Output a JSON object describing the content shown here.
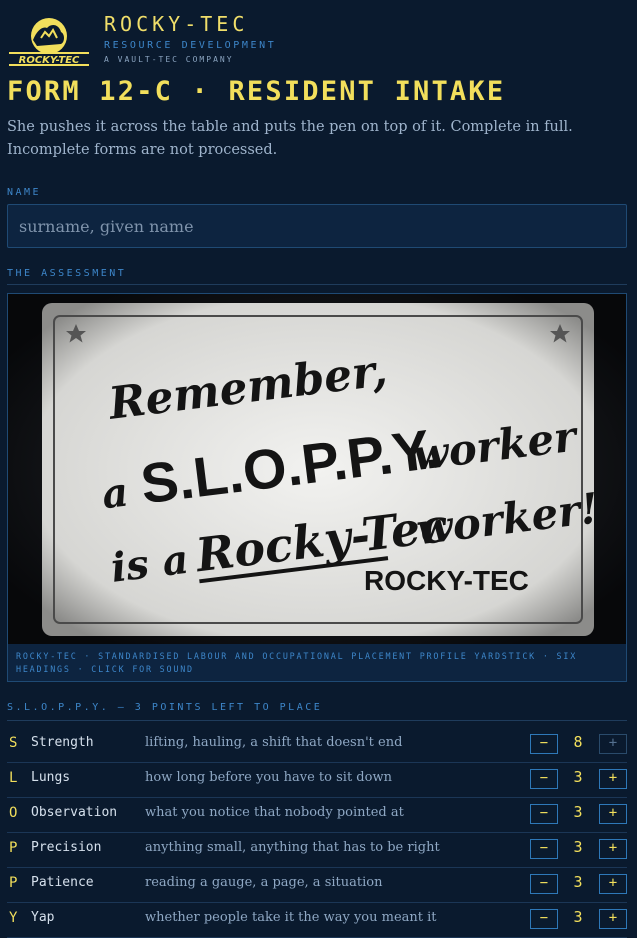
{
  "brand": {
    "name": "ROCKY-TEC",
    "subtitle": "RESOURCE DEVELOPMENT",
    "tagline": "A VAULT-TEC COMPANY",
    "logo_text": "ROCKY-TEC"
  },
  "form": {
    "title": "FORM 12-C · RESIDENT INTAKE",
    "intro": "She pushes it across the table and puts the pen on top of it. Complete in full. Incomplete forms are not processed."
  },
  "name_field": {
    "label": "NAME",
    "placeholder": "surname, given name",
    "value": ""
  },
  "assessment": {
    "label": "THE ASSESSMENT",
    "poster": {
      "line1": "Remember,",
      "line2a": "a",
      "line2b": "S.L.O.P.P.Y.",
      "line2c": "worker",
      "line3a": "is a",
      "line3b": "Rocky-Tec",
      "line3c": "worker!",
      "brand": "ROCKY-TEC"
    },
    "caption": "ROCKY-TEC · STANDARDISED LABOUR AND OCCUPATIONAL PLACEMENT PROFILE YARDSTICK · SIX HEADINGS · CLICK FOR SOUND"
  },
  "sloppy": {
    "label": "S.L.O.P.P.Y. — 3 POINTS LEFT TO PLACE",
    "minus_label": "−",
    "plus_label": "+",
    "stats": [
      {
        "letter": "S",
        "name": "Strength",
        "desc": "lifting, hauling, a shift that doesn't end",
        "value": "8",
        "plus_disabled": true
      },
      {
        "letter": "L",
        "name": "Lungs",
        "desc": "how long before you have to sit down",
        "value": "3",
        "plus_disabled": false
      },
      {
        "letter": "O",
        "name": "Observation",
        "desc": "what you notice that nobody pointed at",
        "value": "3",
        "plus_disabled": false
      },
      {
        "letter": "P",
        "name": "Precision",
        "desc": "anything small, anything that has to be right",
        "value": "3",
        "plus_disabled": false
      },
      {
        "letter": "P",
        "name": "Patience",
        "desc": "reading a gauge, a page, a situation",
        "value": "3",
        "plus_disabled": false
      },
      {
        "letter": "Y",
        "name": "Yap",
        "desc": "whether people take it the way you meant it",
        "value": "3",
        "plus_disabled": false
      }
    ]
  },
  "colors": {
    "background": "#0a1a2e",
    "accent_yellow": "#f2df5c",
    "accent_blue": "#3d86c9",
    "panel": "#0d2440"
  }
}
